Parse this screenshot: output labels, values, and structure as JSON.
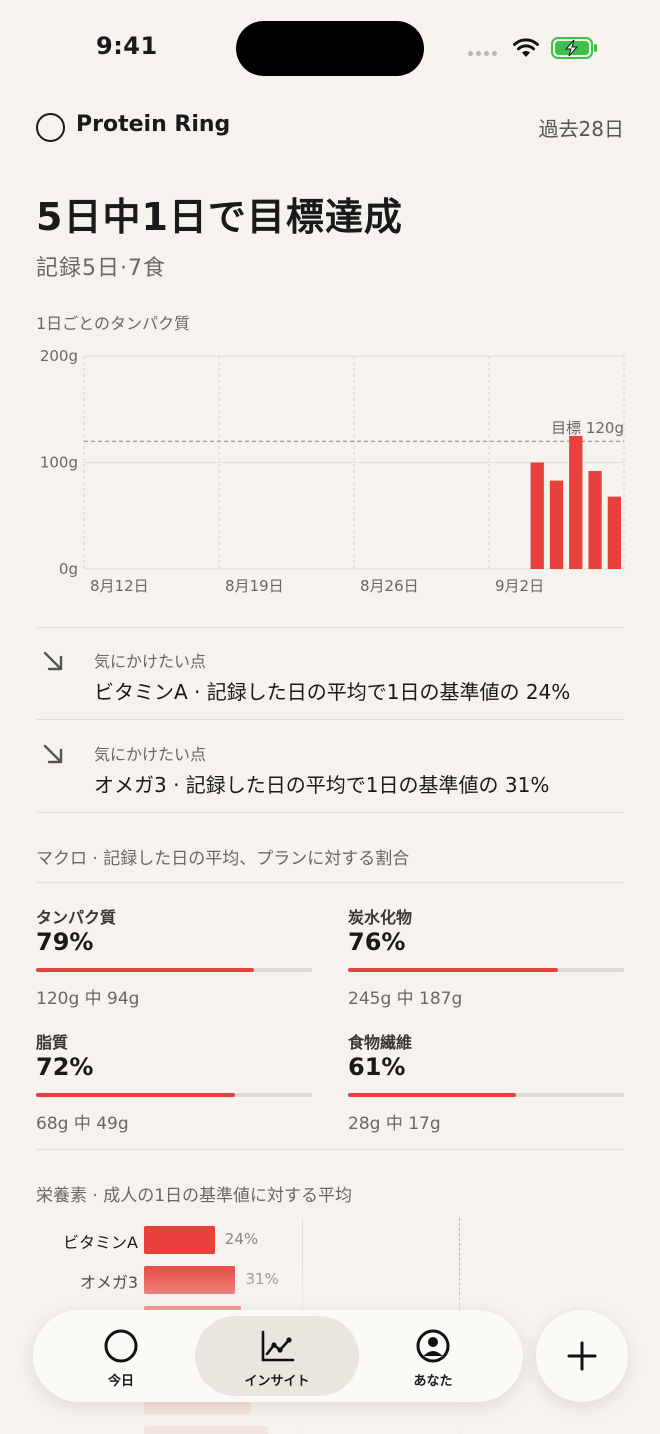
{
  "status": {
    "time": "9:41"
  },
  "header": {
    "app_title": "Protein Ring",
    "range": "過去28日"
  },
  "summary": {
    "headline": "5日中1日で目標達成",
    "subline": "記録5日·7食"
  },
  "chart_data": {
    "type": "bar",
    "title": "1日ごとのタンパク質",
    "y_ticks": [
      "200g",
      "100g",
      "0g"
    ],
    "ylim": [
      0,
      200
    ],
    "x_tick_labels": [
      "8月12日",
      "8月19日",
      "8月26日",
      "9月2日"
    ],
    "goal_value": 120,
    "goal_label": "目標 120g",
    "bars": [
      {
        "day_index": 23,
        "value": 100
      },
      {
        "day_index": 24,
        "value": 83
      },
      {
        "day_index": 25,
        "value": 125
      },
      {
        "day_index": 26,
        "value": 92
      },
      {
        "day_index": 27,
        "value": 68
      }
    ],
    "days_total": 28,
    "colors": {
      "bar": "#e8403a",
      "goal": "#8a8680"
    }
  },
  "flags": [
    {
      "label": "気にかけたい点",
      "text": "ビタミンA · 記録した日の平均で1日の基準値の 24%",
      "icon": "arrow-down-right-icon"
    },
    {
      "label": "気にかけたい点",
      "text": "オメガ3 · 記録した日の平均で1日の基準値の 31%",
      "icon": "arrow-down-right-icon"
    }
  ],
  "macros": {
    "label": "マクロ · 記録した日の平均、プランに対する割合",
    "items": [
      {
        "name": "タンパク質",
        "pct": "79%",
        "progress": 0.79,
        "sub": "120g 中 94g"
      },
      {
        "name": "炭水化物",
        "pct": "76%",
        "progress": 0.76,
        "sub": "245g 中 187g"
      },
      {
        "name": "脂質",
        "pct": "72%",
        "progress": 0.72,
        "sub": "68g 中 49g"
      },
      {
        "name": "食物繊維",
        "pct": "61%",
        "progress": 0.61,
        "sub": "28g 中 17g"
      }
    ]
  },
  "nutrients": {
    "label": "栄養素 · 成人の1日の基準値に対する平均",
    "items": [
      {
        "name": "ビタミンA",
        "pct": "24%",
        "value": 24
      },
      {
        "name": "オメガ3",
        "pct": "31%",
        "value": 31
      },
      {
        "name": "",
        "pct": "",
        "value": 33
      },
      {
        "name": "",
        "pct": "",
        "value": 33
      },
      {
        "name": "",
        "pct": "",
        "value": 36
      },
      {
        "name": "",
        "pct": "",
        "value": 42
      }
    ]
  },
  "tabbar": {
    "tabs": [
      {
        "label": "今日",
        "icon": "ring-icon"
      },
      {
        "label": "インサイト",
        "icon": "chart-icon",
        "active": true
      },
      {
        "label": "あなた",
        "icon": "person-icon"
      }
    ],
    "fab_icon": "plus-icon"
  },
  "colors": {
    "accent": "#e8403a",
    "background": "#f6f3ee"
  }
}
